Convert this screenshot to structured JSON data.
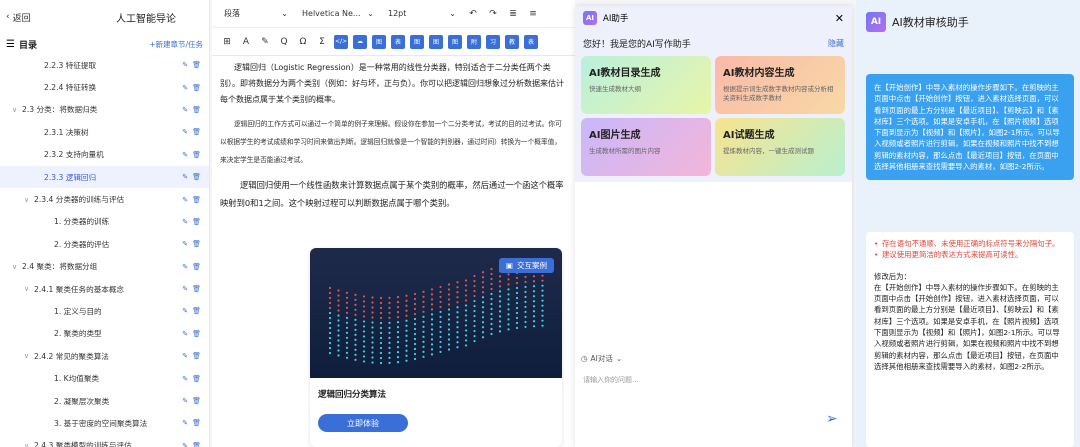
{
  "left": {
    "back_label": "返回",
    "course_title": "人工智能导论",
    "toc_title": "目录",
    "add_label": "+新建章节/任务",
    "items": [
      {
        "label": "2.2.3 特征提取",
        "indent": 34,
        "caret": "",
        "selected": false
      },
      {
        "label": "2.2.4 特征转换",
        "indent": 34,
        "caret": "",
        "selected": false
      },
      {
        "label": "2.3 分类：将数据归类",
        "indent": 12,
        "caret": "∨",
        "selected": false
      },
      {
        "label": "2.3.1 决策树",
        "indent": 34,
        "caret": "",
        "selected": false
      },
      {
        "label": "2.3.2 支持向量机",
        "indent": 34,
        "caret": "",
        "selected": false
      },
      {
        "label": "2.3.3 逻辑回归",
        "indent": 34,
        "caret": "",
        "selected": true
      },
      {
        "label": "2.3.4 分类器的训练与评估",
        "indent": 24,
        "caret": "∨",
        "selected": false
      },
      {
        "label": "1. 分类器的训练",
        "indent": 44,
        "caret": "",
        "selected": false
      },
      {
        "label": "2. 分类器的评估",
        "indent": 44,
        "caret": "",
        "selected": false
      },
      {
        "label": "2.4 聚类：将数据分组",
        "indent": 12,
        "caret": "∨",
        "selected": false
      },
      {
        "label": "2.4.1 聚类任务的基本概念",
        "indent": 24,
        "caret": "∨",
        "selected": false
      },
      {
        "label": "1. 定义与目的",
        "indent": 44,
        "caret": "",
        "selected": false
      },
      {
        "label": "2. 聚类的类型",
        "indent": 44,
        "caret": "",
        "selected": false
      },
      {
        "label": "2.4.2 常见的聚类算法",
        "indent": 24,
        "caret": "∨",
        "selected": false
      },
      {
        "label": "1. K均值聚类",
        "indent": 44,
        "caret": "",
        "selected": false
      },
      {
        "label": "2. 凝聚层次聚类",
        "indent": 44,
        "caret": "",
        "selected": false
      },
      {
        "label": "3. 基于密度的空间聚类算法",
        "indent": 44,
        "caret": "",
        "selected": false
      },
      {
        "label": "2.4.3 聚类模型的训练与评估",
        "indent": 24,
        "caret": "∨",
        "selected": false
      }
    ]
  },
  "editor": {
    "paragraph_style": "段落",
    "font_name": "Helvetica Ne...",
    "font_size": "12pt",
    "tools2": [
      "⊞",
      "A",
      "✎",
      "Q",
      "Ω",
      "Σ",
      "</>",
      "☁",
      "图",
      "表",
      "图",
      "图",
      "图",
      "附",
      "习",
      "教",
      "表"
    ],
    "p1": "逻辑回归（Logistic Regression）是一种常用的线性分类器，特别适合于二分类任两个类别）。即将数据分为两个类别（例如：好与坏，正与负）。你可以把逻辑回归想象过分析数据来估计每个数据点属于某个类别的概率。",
    "p2": "逻辑回归的工作方式可以通过一个简单的例子来理解。假设你在参加一个二分类考试，考试的目的过考试。你可以根据学生的考试成绩和学习时间来做出判断。逻辑回归就像是一个智能的判别器，通过时间）转换为一个概率值，来决定学生是否能通过考试。",
    "p3": "逻辑回归使用一个线性函数来计算数据点属于某个类别的概率，然后通过一个函这个概率映射到0和1之间。这个映射过程可以判断数据点属于哪个类别。",
    "card_tag": "交互案例",
    "card_caption": "逻辑回归分类算法",
    "card_button": "立即体验"
  },
  "ai_panel": {
    "title": "AI助手",
    "greeting": "您好！我是您的AI写作助手",
    "hide_label": "隐藏",
    "cards": [
      {
        "title": "AI教材目录生成",
        "desc": "快速生成教材大纲"
      },
      {
        "title": "AI教材内容生成",
        "desc": "根据提示词生成数字教材内容或分析相关资料生成数字教材"
      },
      {
        "title": "AI图片生成",
        "desc": "生成教材所需的图片内容"
      },
      {
        "title": "AI试题生成",
        "desc": "提炼教材内容，一键生成测试题"
      }
    ],
    "chat_mode": "AI对话",
    "input_placeholder": "请输入你的问题..."
  },
  "review": {
    "title": "AI教材审核助手",
    "user_message": "在【开始创作】中导入素材的操作步骤如下。在剪映的主页面中点击【开始创作】按钮，进入素材选择页面，可以看到页面的最上方分别是【最近项目】、【剪映云】和【素材库】三个选项。如果是安卓手机，在【照片视频】选项下面到显示为【视频】和【照片】，如图2-1所示。可以导入视频或者照片进行剪辑，如果在视频和照片中找不到想剪辑的素材内容，那么点击【最近项目】按钮，在页面中选择其他相册来查找需要导入的素材，如图2-2所示。",
    "issues": [
      "存在语句不通顺、未使用正确的标点符号来分隔句子。",
      "建议使用更简洁的表达方式来提高可读性。"
    ],
    "revised_label": "修改后为：",
    "revised": "在【开始创作】中导入素材的操作步骤如下。在剪映的主页面中点击【开始创作】按钮，进入素材选择页面，可以看到页面的最上方分别是【最近项目】、【剪映云】和【素材库】三个选项。如果是安卓手机，在【照片视频】选项下面则显示为【视频】和【照片】，如图2-1所示。可以导入视频或者照片进行剪辑，如果在视频和照片中找不到想剪辑的素材内容，那么点击【最近项目】按钮，在页面中选择其他相册来查找需要导入的素材，如图2-2所示。"
  },
  "colors": {
    "accent": "#3b6fd8",
    "review_bg": "#e9f1fb",
    "bubble": "#3aa0f0",
    "issue_red": "#e0453a"
  }
}
